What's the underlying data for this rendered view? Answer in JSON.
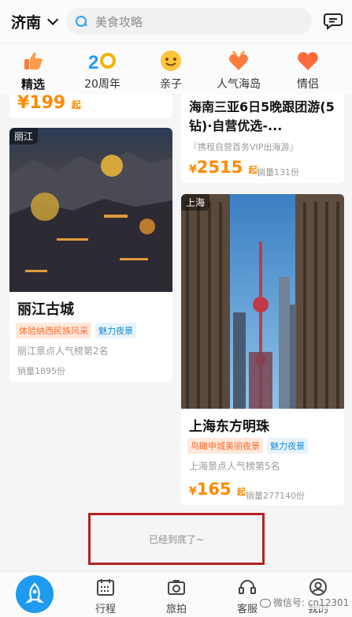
{
  "header": {
    "city": "济南",
    "search_placeholder": "美食攻略"
  },
  "categories": [
    {
      "label": "精选",
      "icon": "thumbs-up-icon",
      "active": true
    },
    {
      "label": "20周年",
      "icon": "anniversary-20-icon",
      "active": false
    },
    {
      "label": "亲子",
      "icon": "smiley-face-icon",
      "active": false
    },
    {
      "label": "人气海岛",
      "icon": "heart-hands-icon",
      "active": false
    },
    {
      "label": "情侣",
      "icon": "heart-icon",
      "active": false
    }
  ],
  "cards": {
    "top_left_partial_price": "199",
    "top_left_partial_unit": "起",
    "hainan": {
      "title": "海南三亚6日5晚跟团游(5钻)·自营优选-...",
      "subtitle": "『携程自营首务VIP出海游』",
      "price_symbol": "¥",
      "price": "2515",
      "price_unit": "起",
      "sales": "销量131份"
    },
    "lijiang": {
      "badge": "丽江",
      "title": "丽江古城",
      "tag1": "体验纳西民族风采",
      "tag2": "魅力夜景",
      "rank": "丽江景点人气榜第2名",
      "sales": "销量1895份"
    },
    "shanghai": {
      "badge": "上海",
      "title": "上海东方明珠",
      "tag1": "鸟瞰申城美丽夜景",
      "tag2": "魅力夜景",
      "rank": "上海景点人气榜第5名",
      "price_symbol": "¥",
      "price": "165",
      "price_unit": "起",
      "sales": "销量277140份"
    }
  },
  "end_message": "已经到底了~",
  "bottom_nav": [
    {
      "label": "行程",
      "icon": "calendar-icon"
    },
    {
      "label": "旅拍",
      "icon": "camera-icon"
    },
    {
      "label": "客服",
      "icon": "headset-icon"
    },
    {
      "label": "我的",
      "icon": "user-icon"
    }
  ],
  "watermark": "微信号: cn12301",
  "colors": {
    "accent": "#2aa3ff",
    "price": "#ff8a00",
    "highlight_box": "#b3231f"
  }
}
